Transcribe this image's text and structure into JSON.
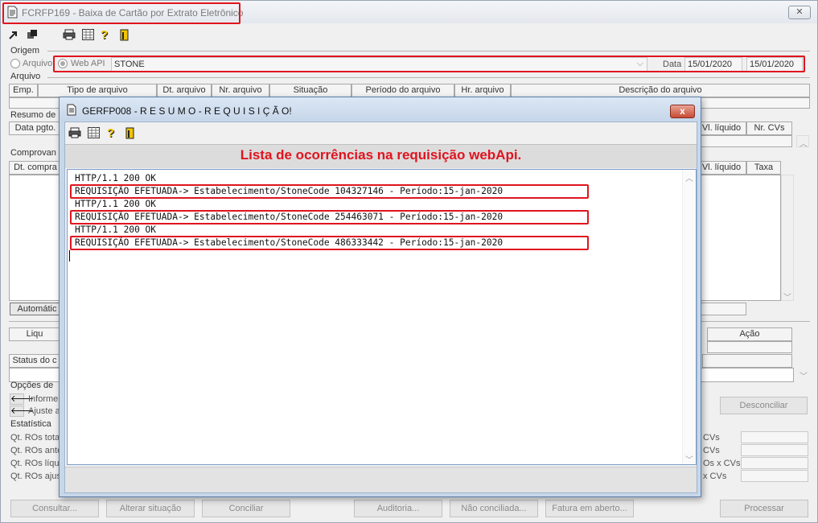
{
  "main": {
    "title": "FCRFP169 - Baixa de Cartão por Extrato Eletrônico",
    "close_glyph": "✕",
    "origem": {
      "label": "Origem",
      "radio_arquivo": "Arquivo",
      "radio_webapi": "Web API",
      "operadora": "STONE",
      "data_label": "Data",
      "data_inicio": "15/01/2020",
      "data_fim": "15/01/2020"
    },
    "arquivo": {
      "label": "Arquivo",
      "columns": [
        "Emp.",
        "Tipo de arquivo",
        "Dt. arquivo",
        "Nr. arquivo",
        "Situação",
        "Período do arquivo",
        "Hr. arquivo",
        "Descrição do arquivo"
      ]
    },
    "resumo": {
      "label": "Resumo de",
      "col_data_pgto": "Data pgto.",
      "col_vl_liquido": "Vl. líquido",
      "col_nr_cvs": "Nr. CVs"
    },
    "comprovantes": {
      "label": "Comprovan",
      "col_dt_compra": "Dt. compra",
      "col_vl_liquido": "Vl. líquido",
      "col_taxa": "Taxa",
      "automatic_btn": "Automátic"
    },
    "lower": {
      "liq": "Liqu",
      "acao": "Ação",
      "status_label": "Status do c"
    },
    "opcoes": {
      "label": "Opções de",
      "informe": "Informe",
      "ajuste": "Ajuste a",
      "desconciliar": "Desconciliar"
    },
    "estatistica": {
      "label": "Estatística",
      "rows_left": [
        "Qt. ROs tota",
        "Qt. ROs ante",
        "Qt. ROs líqui",
        "Qt. ROs ajus"
      ],
      "rows_right": [
        "CVs",
        "CVs",
        "Os x CVs",
        "x CVs"
      ]
    },
    "buttons": {
      "consultar": "Consultar...",
      "alterar": "Alterar situação",
      "conciliar": "Conciliar",
      "auditoria": "Auditoria...",
      "nao_conciliada": "Não conciliada...",
      "fatura": "Fatura em aberto...",
      "processar": "Processar"
    }
  },
  "dialog": {
    "title": "GERFP008 - R E S U M O - R E Q U I S I Ç Ã O!",
    "close_glyph": "x",
    "heading": "Lista de ocorrências na requisição webApi.",
    "heading_color": "#e0141e",
    "log_lines": [
      "HTTP/1.1 200 OK",
      "REQUISIÇÃO EFETUADA-> Estabelecimento/StoneCode 104327146 - Período:15-jan-2020",
      "HTTP/1.1 200 OK",
      "REQUISIÇÃO EFETUADA-> Estabelecimento/StoneCode 254463071 - Período:15-jan-2020",
      "HTTP/1.1 200 OK",
      "REQUISIÇÃO EFETUADA-> Estabelecimento/StoneCode 486333442 - Período:15-jan-2020"
    ]
  },
  "icons": {
    "toolbar_main": [
      "export-icon",
      "copy-icon",
      "print-icon",
      "table-icon",
      "help-icon",
      "exit-icon"
    ],
    "toolbar_dialog": [
      "print-icon",
      "table-icon",
      "help-icon",
      "exit-icon"
    ]
  }
}
